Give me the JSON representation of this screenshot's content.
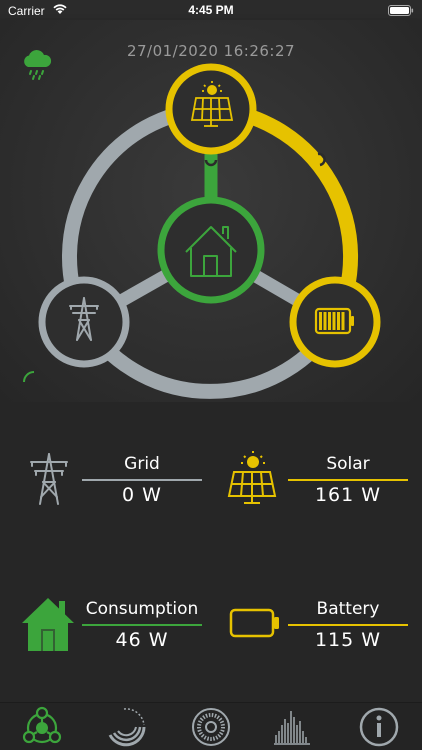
{
  "status_bar": {
    "carrier": "Carrier",
    "time": "4:45 PM"
  },
  "header": {
    "timestamp": "27/01/2020 16:26:27",
    "weather_icon": "rain-cloud-icon"
  },
  "diagram": {
    "nodes": [
      {
        "name": "solar",
        "icon": "solar-panel-icon",
        "color": "#e6c200"
      },
      {
        "name": "home",
        "icon": "house-icon",
        "color": "#3ca53c"
      },
      {
        "name": "grid",
        "icon": "pylon-icon",
        "color": "#a0a8ad"
      },
      {
        "name": "battery",
        "icon": "battery-icon",
        "color": "#e6c200"
      }
    ]
  },
  "stats": {
    "grid": {
      "label": "Grid",
      "value": "0 W",
      "icon": "pylon-icon",
      "color": "#a0a8ad"
    },
    "solar": {
      "label": "Solar",
      "value": "161 W",
      "icon": "solar-panel-icon",
      "color": "#e6c200"
    },
    "consumption": {
      "label": "Consumption",
      "value": "46 W",
      "icon": "house-icon",
      "color": "#3ca53c"
    },
    "battery": {
      "label": "Battery",
      "value": "115 W",
      "icon": "battery-icon",
      "color": "#e6c200"
    }
  },
  "tabs": [
    {
      "name": "flow",
      "icon": "energy-flow-icon",
      "active": true
    },
    {
      "name": "gauge",
      "icon": "gauge-icon",
      "active": false
    },
    {
      "name": "history",
      "icon": "radial-history-icon",
      "active": false
    },
    {
      "name": "statistics",
      "icon": "bar-histogram-icon",
      "active": false
    },
    {
      "name": "info",
      "icon": "info-icon",
      "active": false
    }
  ],
  "colors": {
    "grey": "#a0a8ad",
    "yellow": "#e6c200",
    "green": "#3ca53c",
    "background": "#2b2b2b"
  }
}
